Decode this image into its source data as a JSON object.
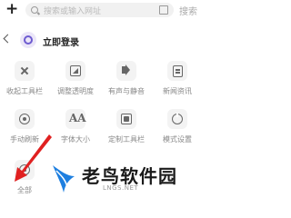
{
  "topbar": {
    "search_placeholder": "搜索或输入网址",
    "search_button": "搜索"
  },
  "login": {
    "text": "立即登录"
  },
  "grid": [
    {
      "label": "收起工具栏",
      "icon": "collapse-icon"
    },
    {
      "label": "调整透明度",
      "icon": "opacity-icon"
    },
    {
      "label": "有声与静音",
      "icon": "sound-icon"
    },
    {
      "label": "新闻资讯",
      "icon": "news-icon"
    },
    {
      "label": "手动刷新",
      "icon": "refresh-icon"
    },
    {
      "label": "字体大小",
      "icon": "font-size-icon"
    },
    {
      "label": "定制工具栏",
      "icon": "customize-toolbar-icon"
    },
    {
      "label": "模式设置",
      "icon": "mode-settings-icon"
    },
    {
      "label": "全部",
      "icon": "all-icon"
    }
  ],
  "watermark": {
    "brand": "老鸟软件园",
    "domain": "LNGS.NET"
  },
  "colors": {
    "accent": "#6d5bd0",
    "arrow": "#e02020",
    "brand_blue": "#1e7fe0"
  }
}
